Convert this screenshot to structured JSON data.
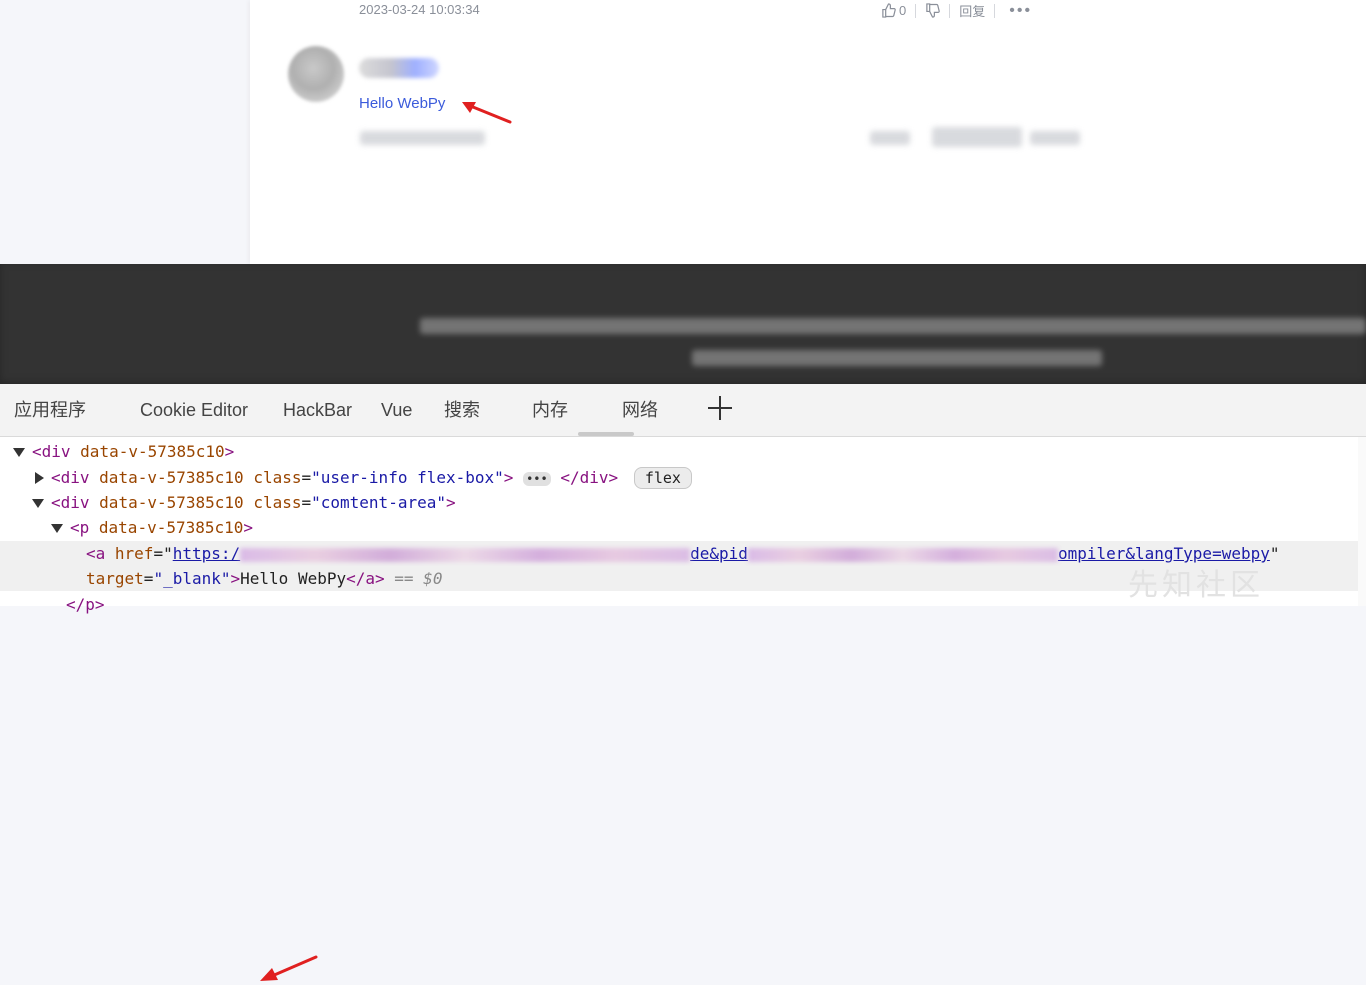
{
  "comment": {
    "timestamp": "2023-03-24 10:03:34",
    "like_count": "0",
    "reply_label": "回复",
    "more_label": "•••",
    "reply_text": "Hello WebPy"
  },
  "devtools": {
    "tabs": [
      "应用程序",
      "Cookie Editor",
      "HackBar",
      "Vue",
      "搜索",
      "内存",
      "网络"
    ],
    "add_tab_label": "+",
    "dom": {
      "line1_open": "<div",
      "line1_attr": "data-v-57385c10",
      "line1_close": ">",
      "line2_open": "<div",
      "line2_attr1": "data-v-57385c10",
      "line2_attr2_name": "class",
      "line2_attr2_value": "\"user-info flex-box\"",
      "line2_close": ">",
      "line2_ellipsis": "•••",
      "line2_end": "</div>",
      "line2_badge": "flex",
      "line3_open": "<div",
      "line3_attr1": "data-v-57385c10",
      "line3_attr2_name": "class",
      "line3_attr2_value": "\"comtent-area\"",
      "line3_close": ">",
      "line4_open": "<p",
      "line4_attr": "data-v-57385c10",
      "line4_close": ">",
      "line5_open": "<a",
      "line5_attr_name": "href",
      "line5_href_start": "https:/",
      "line5_href_mid": "de&pid",
      "line5_href_end": "ompiler&langType=webpy",
      "line6_attr_name": "target",
      "line6_attr_value": "\"_blank\"",
      "line6_text": "Hello WebPy",
      "line6_close": "</a>",
      "line6_eq": "== $0",
      "line7": "</p>"
    }
  },
  "watermark": "先知社区"
}
